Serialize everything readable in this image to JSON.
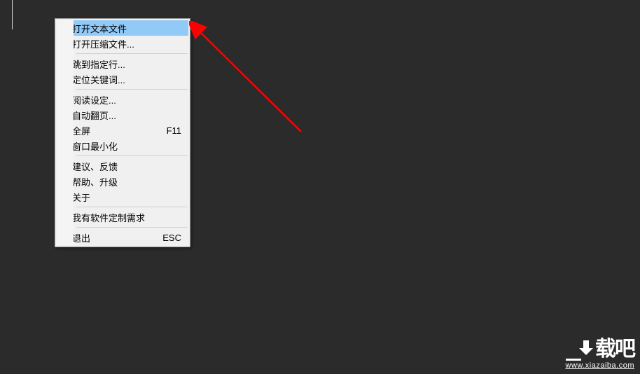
{
  "menu": {
    "items": [
      {
        "label": "打开文本文件",
        "shortcut": "",
        "checked": false,
        "highlight": true
      },
      {
        "label": "打开压缩文件...",
        "shortcut": "",
        "checked": false,
        "highlight": false
      },
      {
        "sep": true
      },
      {
        "label": "跳到指定行...",
        "shortcut": "",
        "checked": false,
        "highlight": false
      },
      {
        "label": "定位关键词...",
        "shortcut": "",
        "checked": false,
        "highlight": false
      },
      {
        "sep": true
      },
      {
        "label": "阅读设定...",
        "shortcut": "",
        "checked": false,
        "highlight": false
      },
      {
        "label": "自动翻页...",
        "shortcut": "",
        "checked": false,
        "highlight": false
      },
      {
        "label": "全屏",
        "shortcut": "F11",
        "checked": true,
        "highlight": false
      },
      {
        "label": "窗口最小化",
        "shortcut": "",
        "checked": false,
        "highlight": false
      },
      {
        "sep": true
      },
      {
        "label": "建议、反馈",
        "shortcut": "",
        "checked": false,
        "highlight": false
      },
      {
        "label": "帮助、升级",
        "shortcut": "",
        "checked": false,
        "highlight": false
      },
      {
        "label": "关于",
        "shortcut": "",
        "checked": false,
        "highlight": false
      },
      {
        "sep": true
      },
      {
        "label": "我有软件定制需求",
        "shortcut": "",
        "checked": false,
        "highlight": false
      },
      {
        "sep": true
      },
      {
        "label": "退出",
        "shortcut": "ESC",
        "checked": false,
        "highlight": false
      }
    ]
  },
  "annotation": {
    "arrow_color": "#ff0000"
  },
  "watermark": {
    "logo_text": "载吧",
    "url": "www.xiazaiba.com"
  }
}
